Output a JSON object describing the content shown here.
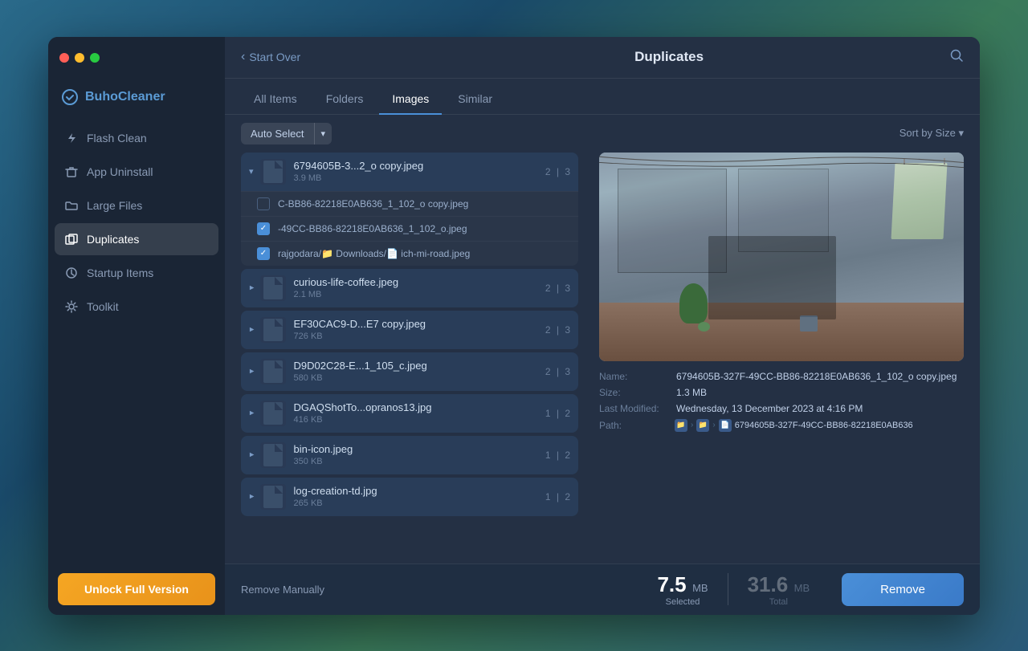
{
  "window": {
    "title": "BuhoCleaner",
    "logo_text": "BuhoCleaner"
  },
  "header": {
    "back_label": "Start Over",
    "title": "Duplicates",
    "search_icon": "search-icon"
  },
  "tabs": [
    {
      "label": "All Items",
      "active": false
    },
    {
      "label": "Folders",
      "active": false
    },
    {
      "label": "Images",
      "active": true
    },
    {
      "label": "Similar",
      "active": false
    }
  ],
  "toolbar": {
    "auto_select_label": "Auto Select",
    "sort_label": "Sort by Size ▾"
  },
  "sidebar": {
    "items": [
      {
        "label": "Flash Clean",
        "icon": "flash-icon",
        "active": false
      },
      {
        "label": "App Uninstall",
        "icon": "trash-icon",
        "active": false
      },
      {
        "label": "Large Files",
        "icon": "folder-icon",
        "active": false
      },
      {
        "label": "Duplicates",
        "icon": "duplicate-icon",
        "active": true
      },
      {
        "label": "Startup Items",
        "icon": "startup-icon",
        "active": false
      },
      {
        "label": "Toolkit",
        "icon": "toolkit-icon",
        "active": false
      }
    ],
    "unlock_label": "Unlock Full Version"
  },
  "file_groups": [
    {
      "name": "6794605B-3...2_o copy.jpeg",
      "size": "3.9 MB",
      "count_left": "2",
      "count_right": "3",
      "expanded": true,
      "sub_items": [
        {
          "name": "C-BB86-82218E0AB636_1_102_o copy.jpeg",
          "path": "",
          "checked": false
        },
        {
          "name": "-49CC-BB86-82218E0AB636_1_102_o.jpeg",
          "path": "",
          "checked": true
        },
        {
          "name": "rajgodara/📁 Downloads/📄 ich-mi-road.jpeg",
          "path": "",
          "checked": true
        }
      ]
    },
    {
      "name": "curious-life-coffee.jpeg",
      "size": "2.1 MB",
      "count_left": "2",
      "count_right": "3",
      "expanded": false,
      "sub_items": []
    },
    {
      "name": "EF30CAC9-D...E7 copy.jpeg",
      "size": "726 KB",
      "count_left": "2",
      "count_right": "3",
      "expanded": false,
      "sub_items": []
    },
    {
      "name": "D9D02C28-E...1_105_c.jpeg",
      "size": "580 KB",
      "count_left": "2",
      "count_right": "3",
      "expanded": false,
      "sub_items": []
    },
    {
      "name": "DGAQShotTo...opranos13.jpg",
      "size": "416 KB",
      "count_left": "1",
      "count_right": "2",
      "expanded": false,
      "sub_items": []
    },
    {
      "name": "bin-icon.jpeg",
      "size": "350 KB",
      "count_left": "1",
      "count_right": "2",
      "expanded": false,
      "sub_items": []
    },
    {
      "name": "log-creation-td.jpg",
      "size": "265 KB",
      "count_left": "1",
      "count_right": "2",
      "expanded": false,
      "sub_items": []
    }
  ],
  "preview": {
    "name": "6794605B-327F-49CC-BB86-82218E0AB636_1_102_o copy.jpeg",
    "size": "1.3 MB",
    "last_modified": "Wednesday, 13 December 2023 at 4:16 PM",
    "path_text": "6794605B-327F-49CC-BB86-82218E0AB636"
  },
  "detail_labels": {
    "name": "Name:",
    "size": "Size:",
    "last_modified": "Last Modified:",
    "path": "Path:"
  },
  "footer": {
    "remove_manually_label": "Remove Manually",
    "selected_value": "7.5",
    "selected_unit": "MB",
    "selected_label": "Selected",
    "total_value": "31.6",
    "total_unit": "MB",
    "total_label": "Total",
    "remove_label": "Remove"
  }
}
